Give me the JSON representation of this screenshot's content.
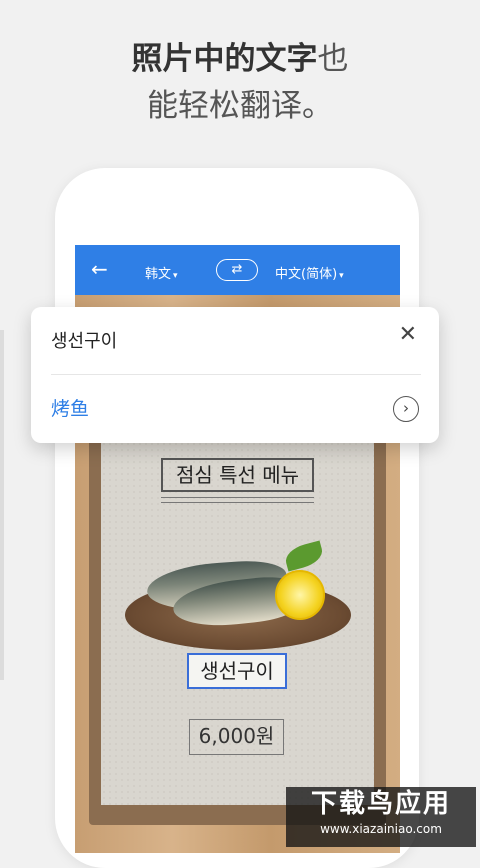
{
  "headline": {
    "line1_bold": "照片中的文字",
    "line1_light": "也",
    "line2": "能轻松翻译。"
  },
  "appbar": {
    "back_icon": "arrow-left-icon",
    "source_lang": "韩文",
    "target_lang": "中文(简体)",
    "swap_icon": "swap-icon"
  },
  "photo_menu": {
    "title": "점심 특선 메뉴",
    "dish": "생선구이",
    "price": "6,000원"
  },
  "translation_card": {
    "source_text": "생선구이",
    "translated_text": "烤鱼",
    "close_icon": "close-icon",
    "next_icon": "chevron-right-icon",
    "accent_color": "#2f7fe6"
  },
  "watermark": {
    "title": "下载鸟应用",
    "url": "www.xiazainiao.com"
  }
}
